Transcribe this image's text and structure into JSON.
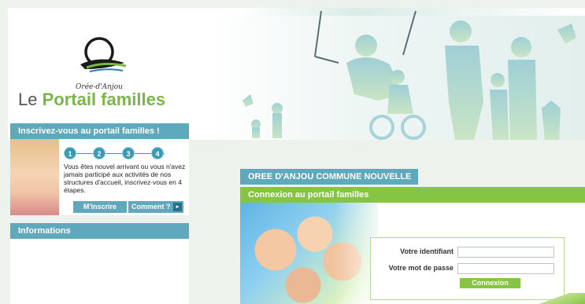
{
  "header": {
    "logo_name": "Orée-d'Anjou",
    "title_prefix": "Le",
    "title_main": "Portail familles"
  },
  "register": {
    "title": "Inscrivez-vous au portail familles !",
    "steps": [
      "1",
      "2",
      "3",
      "4"
    ],
    "text": "Vous êtes nouvel arrivant ou vous n'avez jamais participé aux activités de nos structures d'accueil, inscrivez-vous en 4 étapes.",
    "signup_label": "M'inscrire",
    "howto_label": "Comment ?"
  },
  "info": {
    "title": "Informations"
  },
  "community": {
    "tab_label": "OREE D'ANJOU COMMUNE NOUVELLE"
  },
  "login": {
    "title": "Connexion au portail familles",
    "username_label": "Votre identifiant",
    "password_label": "Votre mot de passe",
    "submit_label": "Connexion"
  },
  "colors": {
    "accent_blue": "#5ea9bb",
    "accent_green": "#86c443"
  }
}
